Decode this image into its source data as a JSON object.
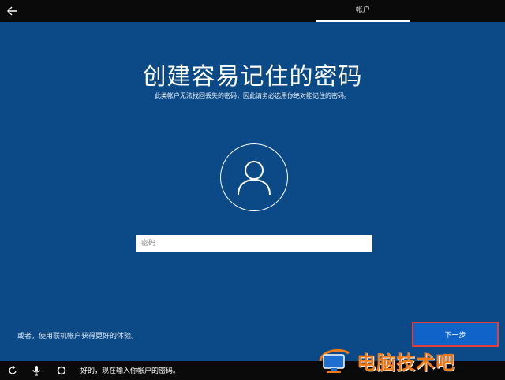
{
  "header": {
    "tab_label": "帐户"
  },
  "main": {
    "title": "创建容易记住的密码",
    "subtitle": "此类帐户无法找回丢失的密码，因此请务必选用你绝对能记住的密码。",
    "password": {
      "placeholder": "密码",
      "value": ""
    },
    "offline_link": "或者，使用联机帐户获得更好的体验。",
    "next_button": "下一步"
  },
  "bottom_bar": {
    "cortana_text": "好的，现在输入你帐户的密码。"
  },
  "watermark": {
    "text": "电脑技术吧"
  }
}
